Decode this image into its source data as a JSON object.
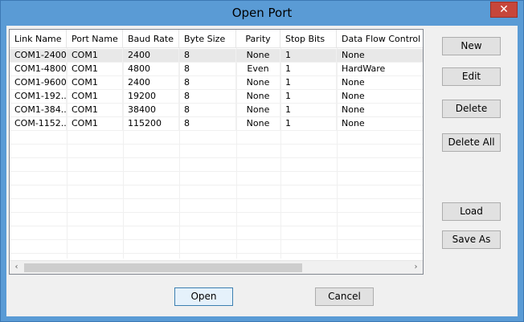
{
  "window": {
    "title": "Open Port",
    "close_glyph": "✕"
  },
  "grid": {
    "columns": [
      "Link Name",
      "Port Name",
      "Baud Rate",
      "Byte Size",
      "Parity",
      "Stop Bits",
      "Data Flow Control"
    ],
    "rows": [
      [
        "COM1-2400",
        "COM1",
        "2400",
        "8",
        "None",
        "1",
        "None"
      ],
      [
        "COM1-4800",
        "COM1",
        "4800",
        "8",
        "Even",
        "1",
        "HardWare"
      ],
      [
        "COM1-9600",
        "COM1",
        "2400",
        "8",
        "None",
        "1",
        "None"
      ],
      [
        "COM1-192...",
        "COM1",
        "19200",
        "8",
        "None",
        "1",
        "None"
      ],
      [
        "COM1-384...",
        "COM1",
        "38400",
        "8",
        "None",
        "1",
        "None"
      ],
      [
        "COM-1152...",
        "COM1",
        "115200",
        "8",
        "None",
        "1",
        "None"
      ]
    ],
    "scroll_left_glyph": "‹",
    "scroll_right_glyph": "›"
  },
  "side_buttons": {
    "new": "New",
    "edit": "Edit",
    "delete": "Delete",
    "delete_all": "Delete All",
    "load": "Load",
    "save_as": "Save As"
  },
  "footer_buttons": {
    "open": "Open",
    "cancel": "Cancel"
  }
}
